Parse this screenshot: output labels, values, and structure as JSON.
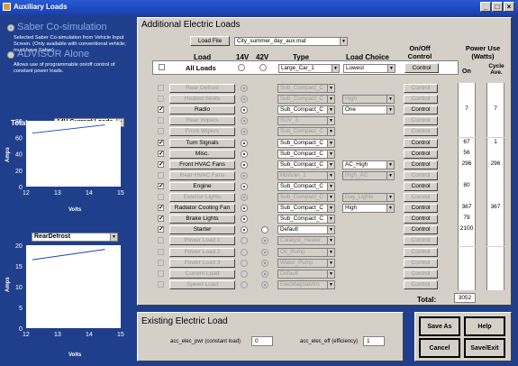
{
  "window": {
    "title": "Auxiliary Loads",
    "min": "_",
    "max": "□",
    "close": "×"
  },
  "left": {
    "option1": {
      "label": "Saber Co-simulation",
      "desc": "Selected Saber Co-simulation from Vehicle Input Screen.  (Only available with conventional vehicle; must have Saber)"
    },
    "option2": {
      "label": "ADVISOR Alone",
      "desc": "Allows use of programmable on/off control of constant power loads."
    },
    "plot1": {
      "total_label": "Total",
      "dropdown": "14V Current Loads",
      "ylabel": "Amps",
      "xlabel": "Volts"
    },
    "plot2": {
      "dropdown": "RearDefrost",
      "ylabel": "Amps",
      "xlabel": "Volts"
    }
  },
  "chart_data": [
    {
      "type": "line",
      "xlabel": "Volts",
      "ylabel": "Amps",
      "xlim": [
        12,
        15
      ],
      "ylim": [
        0,
        80
      ],
      "xticks": [
        "12",
        "13",
        "14",
        "15"
      ],
      "yticks": [
        "0",
        "20",
        "40",
        "60",
        "80"
      ],
      "x": [
        12.2,
        14.5
      ],
      "y": [
        65,
        75
      ]
    },
    {
      "type": "line",
      "xlabel": "Volts",
      "ylabel": "Amps",
      "xlim": [
        12,
        15
      ],
      "ylim": [
        0,
        20
      ],
      "xticks": [
        "12",
        "13",
        "14",
        "15"
      ],
      "yticks": [
        "0",
        "5",
        "10",
        "15",
        "20"
      ],
      "x": [
        12.2,
        14.5
      ],
      "y": [
        16.5,
        19
      ]
    }
  ],
  "ael": {
    "title": "Additional Electric Loads",
    "load_file_btn": "Load File",
    "load_file": "City_summer_day_aux.mat",
    "headers": {
      "load": "Load",
      "v14": "14V",
      "v42": "42V",
      "type": "Type",
      "choice": "Load Choice",
      "onoff": "On/Off Control",
      "power": "Power Use (Watts)",
      "on": "On",
      "cycle": "Cycle Ave."
    },
    "all": {
      "label": "All Loads",
      "type": "Large_Car_1",
      "choice": "Lowest",
      "control": "Control"
    },
    "rows": [
      {
        "label": "Rear Defrost",
        "checked": false,
        "enabled": false,
        "volt": "14",
        "type": "Sub_Compact_C",
        "choice": "",
        "control": "Control",
        "on": "",
        "cyc": ""
      },
      {
        "label": "Heated Seats",
        "checked": false,
        "enabled": false,
        "volt": "14",
        "type": "Sub_Compact_C",
        "choice": "High",
        "control": "Control",
        "on": "",
        "cyc": ""
      },
      {
        "label": "Radio",
        "checked": true,
        "enabled": true,
        "volt": "14",
        "type": "Sub_Compact_C",
        "choice": "One",
        "control": "Control",
        "on": "7",
        "cyc": "7"
      },
      {
        "label": "Rear Wipers",
        "checked": false,
        "enabled": false,
        "volt": "14",
        "type": "SUV_3",
        "choice": "",
        "control": "Control",
        "on": "",
        "cyc": ""
      },
      {
        "label": "Front Wipers",
        "checked": false,
        "enabled": false,
        "volt": "14",
        "type": "Sub_Compact_C",
        "choice": "",
        "control": "Control",
        "on": "",
        "cyc": ""
      },
      {
        "label": "Turn Signals",
        "checked": true,
        "enabled": true,
        "volt": "14",
        "type": "Sub_Compact_C",
        "choice": "",
        "control": "Control",
        "on": "67",
        "cyc": "1"
      },
      {
        "label": "Misc.",
        "checked": true,
        "enabled": true,
        "volt": "14",
        "type": "Sub_Compact_C",
        "choice": "",
        "control": "Control",
        "on": "56",
        "cyc": ""
      },
      {
        "label": "Front HVAC Fans",
        "checked": true,
        "enabled": true,
        "volt": "14",
        "type": "Sub_Compact_C",
        "choice": "AC_High",
        "control": "Control",
        "on": "296",
        "cyc": "296"
      },
      {
        "label": "Rear HVAC Fans",
        "checked": false,
        "enabled": false,
        "volt": "14",
        "type": "Minivan_1",
        "choice": "High_AC",
        "control": "Control",
        "on": "",
        "cyc": ""
      },
      {
        "label": "Engine",
        "checked": true,
        "enabled": true,
        "volt": "14",
        "type": "Sub_Compact_C",
        "choice": "",
        "control": "Control",
        "on": "80",
        "cyc": ""
      },
      {
        "label": "Exterior Lights",
        "checked": false,
        "enabled": false,
        "volt": "14",
        "type": "Sub_Compact_C",
        "choice": "Day_Lights",
        "control": "Control",
        "on": "",
        "cyc": ""
      },
      {
        "label": "Radiator Cooling Fan",
        "checked": true,
        "enabled": true,
        "volt": "14",
        "type": "Sub_Compact_C",
        "choice": "High",
        "control": "Control",
        "on": "367",
        "cyc": "367"
      },
      {
        "label": "Brake Lights",
        "checked": true,
        "enabled": true,
        "volt": "14",
        "type": "Sub_Compact_C",
        "choice": "",
        "control": "Control",
        "on": "79",
        "cyc": ""
      },
      {
        "label": "Starter",
        "checked": true,
        "enabled": true,
        "volt": "14",
        "type": "Default",
        "choice": "",
        "control": "Control",
        "on": "2100",
        "cyc": ""
      },
      {
        "label": "Power Load 1",
        "checked": false,
        "enabled": false,
        "volt": "42",
        "type": "Catalyst_Heater",
        "choice": "",
        "control": "Control",
        "on": "",
        "cyc": ""
      },
      {
        "label": "Power Load 2",
        "checked": false,
        "enabled": false,
        "volt": "42",
        "type": "Oil_Pump",
        "choice": "",
        "control": "Control",
        "on": "",
        "cyc": ""
      },
      {
        "label": "Power Load 3",
        "checked": false,
        "enabled": false,
        "volt": "42",
        "type": "Water_Pump",
        "choice": "",
        "control": "Control",
        "on": "",
        "cyc": ""
      },
      {
        "label": "Current Load",
        "checked": false,
        "enabled": false,
        "volt": "42",
        "type": "Default",
        "choice": "",
        "control": "Control",
        "on": "",
        "cyc": ""
      },
      {
        "label": "Speed Load",
        "checked": false,
        "enabled": false,
        "volt": "42",
        "type": "ElecMagValvtrn",
        "choice": "",
        "control": "Control",
        "on": "",
        "cyc": ""
      }
    ],
    "total_label": "Total:",
    "total": "3052"
  },
  "eel": {
    "title": "Existing Electric Load",
    "pwr_label": "acc_elec_pwr (constant load)",
    "pwr": "0",
    "eff_label": "acc_elec_eff (efficiency)",
    "eff": "1"
  },
  "buttons": {
    "save_as": "Save As",
    "help": "Help",
    "cancel": "Cancel",
    "save_exit": "Save/Exit"
  }
}
